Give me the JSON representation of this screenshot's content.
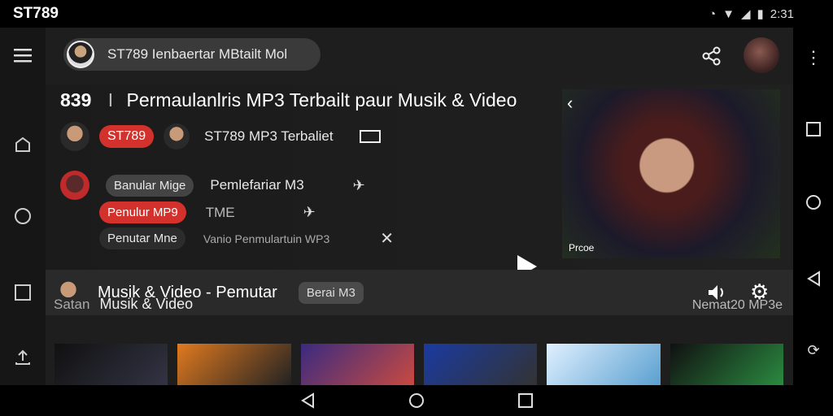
{
  "status": {
    "title": "ST789",
    "time": "2:31"
  },
  "topbar": {
    "search_text": "ST789 Ienbaertar MBtailt Mol"
  },
  "hero": {
    "number": "839",
    "sep": "I",
    "title": "Permaulanlris MP3 Terbailt paur Musik & Video",
    "row1": {
      "badge": "ST789",
      "text": "ST789 MP3 Terbaliet"
    },
    "row2": {
      "badge": "Banular Mige",
      "text": "Pemlefariar M3"
    },
    "row3": {
      "badge": "Penulur MP9",
      "text": "TME",
      "subtext": "Vanio Penmulartuin WP3"
    },
    "row4": {
      "badge": "Penutar Mne"
    },
    "video_label": "Prcoe"
  },
  "bar2": {
    "title": "Musik & Video - Pemutar",
    "badge": "Berai M3"
  },
  "section": {
    "label": "Satan",
    "title": "Musik & Video",
    "right": "Nemat20 MP3e"
  },
  "thumbs": [
    {
      "name": "thumb-1",
      "c1": "#111",
      "c2": "#334"
    },
    {
      "name": "thumb-2",
      "c1": "#e07a20",
      "c2": "#222"
    },
    {
      "name": "thumb-3",
      "c1": "#3a2a80",
      "c2": "#c84a40"
    },
    {
      "name": "thumb-4",
      "c1": "#1a3aa0",
      "c2": "#333"
    },
    {
      "name": "thumb-5",
      "c1": "#e0f0ff",
      "c2": "#5aa0d0"
    },
    {
      "name": "thumb-6",
      "c1": "#111",
      "c2": "#2a8a40"
    }
  ],
  "colors": {
    "accent": "#d3312b",
    "surface": "#1e1e1e",
    "bar": "#2a2a2a"
  }
}
